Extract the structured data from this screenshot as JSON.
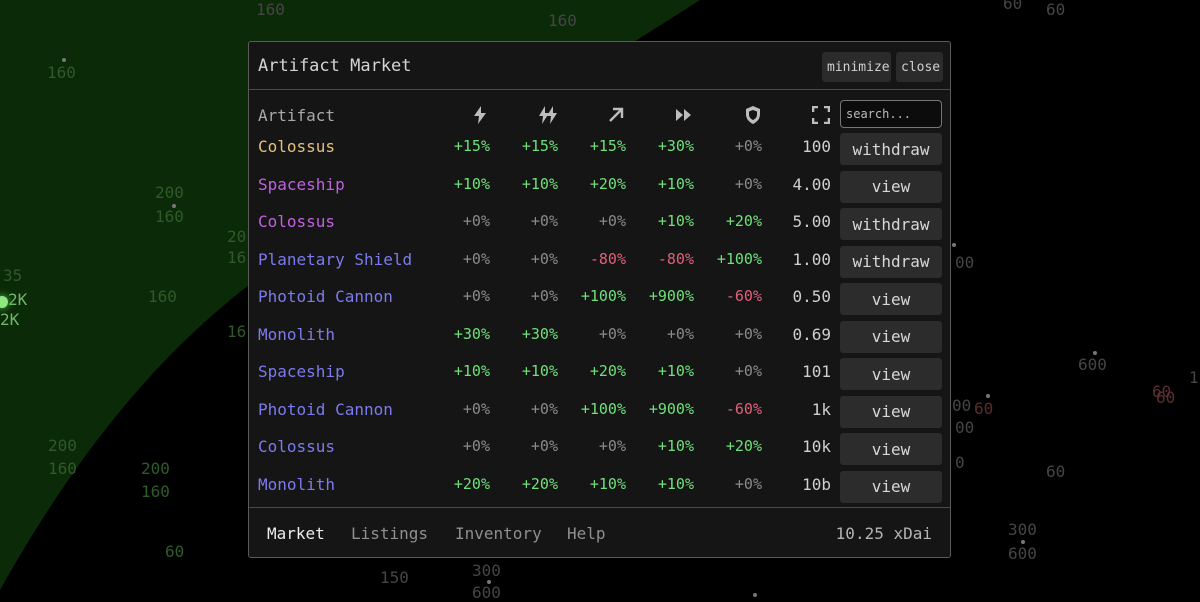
{
  "map": {
    "labels": [
      {
        "text": "160",
        "cls": "dim"
      },
      {
        "text": "160",
        "cls": "dim"
      },
      {
        "text": "160",
        "cls": ""
      },
      {
        "text": "60",
        "cls": "dim"
      },
      {
        "text": "200",
        "cls": ""
      },
      {
        "text": "160",
        "cls": ""
      },
      {
        "text": "20",
        "cls": ""
      },
      {
        "text": "16",
        "cls": ""
      },
      {
        "text": "35",
        "cls": ""
      },
      {
        "text": "2K",
        "cls": "bright"
      },
      {
        "text": "2K",
        "cls": "bright"
      },
      {
        "text": "160",
        "cls": ""
      },
      {
        "text": "16",
        "cls": ""
      },
      {
        "text": "200",
        "cls": ""
      },
      {
        "text": "160",
        "cls": ""
      },
      {
        "text": "200",
        "cls": ""
      },
      {
        "text": "160",
        "cls": ""
      },
      {
        "text": "60",
        "cls": ""
      },
      {
        "text": "150",
        "cls": "dim"
      },
      {
        "text": "300",
        "cls": "dim"
      },
      {
        "text": "600",
        "cls": "dim"
      },
      {
        "text": "600",
        "cls": "dim"
      },
      {
        "text": "300",
        "cls": "dim"
      },
      {
        "text": "600",
        "cls": "dim"
      },
      {
        "text": "60",
        "cls": "dim"
      },
      {
        "text": "00",
        "cls": "dim"
      },
      {
        "text": "60",
        "cls": "red"
      },
      {
        "text": "60",
        "cls": "red"
      },
      {
        "text": "60",
        "cls": "red"
      },
      {
        "text": "00",
        "cls": "dim"
      },
      {
        "text": "00",
        "cls": "dim"
      },
      {
        "text": "0",
        "cls": "dim"
      },
      {
        "text": "60",
        "cls": "dim"
      },
      {
        "text": "1",
        "cls": "dim"
      }
    ]
  },
  "modal": {
    "title": "Artifact Market",
    "minimize_label": "minimize",
    "close_label": "close",
    "header": {
      "artifact_label": "Artifact"
    },
    "columns": [
      {
        "icon": "energy-icon"
      },
      {
        "icon": "energy-growth-icon"
      },
      {
        "icon": "range-icon"
      },
      {
        "icon": "speed-icon"
      },
      {
        "icon": "defense-icon"
      },
      {
        "icon": "expand-icon"
      }
    ],
    "search": {
      "placeholder": "search..."
    },
    "rows": [
      {
        "name": "Colossus",
        "color": "#e5c07b",
        "stats": [
          "+15%",
          "+15%",
          "+15%",
          "+30%",
          "+0%"
        ],
        "price": "100",
        "action": "withdraw"
      },
      {
        "name": "Spaceship",
        "color": "#c061e0",
        "stats": [
          "+10%",
          "+10%",
          "+20%",
          "+10%",
          "+0%"
        ],
        "price": "4.00",
        "action": "view"
      },
      {
        "name": "Colossus",
        "color": "#c061e0",
        "stats": [
          "+0%",
          "+0%",
          "+0%",
          "+10%",
          "+20%"
        ],
        "price": "5.00",
        "action": "withdraw"
      },
      {
        "name": "Planetary Shield",
        "color": "#7b7bef",
        "stats": [
          "+0%",
          "+0%",
          "-80%",
          "-80%",
          "+100%"
        ],
        "price": "1.00",
        "action": "withdraw"
      },
      {
        "name": "Photoid Cannon",
        "color": "#7b7bef",
        "stats": [
          "+0%",
          "+0%",
          "+100%",
          "+900%",
          "-60%"
        ],
        "price": "0.50",
        "action": "view"
      },
      {
        "name": "Monolith",
        "color": "#7b7bef",
        "stats": [
          "+30%",
          "+30%",
          "+0%",
          "+0%",
          "+0%"
        ],
        "price": "0.69",
        "action": "view"
      },
      {
        "name": "Spaceship",
        "color": "#7b7bef",
        "stats": [
          "+10%",
          "+10%",
          "+20%",
          "+10%",
          "+0%"
        ],
        "price": "101",
        "action": "view"
      },
      {
        "name": "Photoid Cannon",
        "color": "#7b7bef",
        "stats": [
          "+0%",
          "+0%",
          "+100%",
          "+900%",
          "-60%"
        ],
        "price": "1k",
        "action": "view"
      },
      {
        "name": "Colossus",
        "color": "#7b7bef",
        "stats": [
          "+0%",
          "+0%",
          "+0%",
          "+10%",
          "+20%"
        ],
        "price": "10k",
        "action": "view"
      },
      {
        "name": "Monolith",
        "color": "#7b7bef",
        "stats": [
          "+20%",
          "+20%",
          "+10%",
          "+10%",
          "+0%"
        ],
        "price": "10b",
        "action": "view"
      }
    ],
    "footer": {
      "tabs": [
        {
          "label": "Market",
          "active": true
        },
        {
          "label": "Listings",
          "active": false
        },
        {
          "label": "Inventory",
          "active": false
        },
        {
          "label": "Help",
          "active": false
        }
      ],
      "balance": "10.25 xDai"
    }
  }
}
